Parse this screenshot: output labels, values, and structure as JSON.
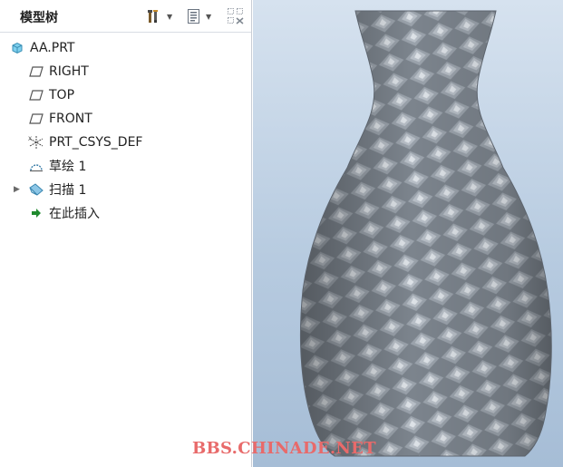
{
  "panel": {
    "title": "模型树",
    "tools": [
      {
        "name": "settings-tool-icon"
      },
      {
        "name": "show-list-icon"
      },
      {
        "name": "filter-tree-icon"
      }
    ]
  },
  "tree": {
    "items": [
      {
        "label": "AA.PRT",
        "icon": "part-icon"
      },
      {
        "label": "RIGHT",
        "icon": "datum-plane-icon"
      },
      {
        "label": "TOP",
        "icon": "datum-plane-icon"
      },
      {
        "label": "FRONT",
        "icon": "datum-plane-icon"
      },
      {
        "label": "PRT_CSYS_DEF",
        "icon": "coordinate-system-icon"
      },
      {
        "label": "草绘 1",
        "icon": "sketch-icon"
      },
      {
        "label": "扫描 1",
        "icon": "sweep-icon"
      },
      {
        "label": "在此插入",
        "icon": "insert-here-arrow-icon"
      }
    ]
  },
  "viewport": {
    "model": "vase",
    "background_top": "#d6e2ef",
    "background_bottom": "#a6bdd6",
    "surface_color": "#8a919a"
  },
  "watermark": "BBS.CHINADE.NET"
}
